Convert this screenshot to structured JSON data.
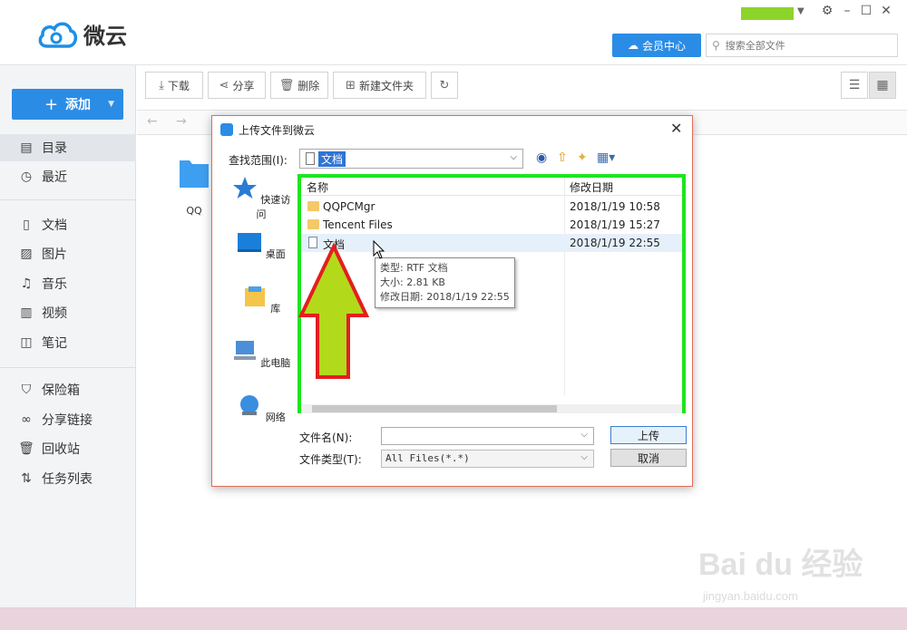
{
  "app": {
    "name": "微云",
    "vip_label": "会员中心",
    "search_placeholder": "搜索全部文件",
    "user_color": "#8dd42a"
  },
  "window_controls": [
    "gear-icon",
    "minimize-icon",
    "maximize-icon",
    "close-icon"
  ],
  "sidebar": {
    "add_label": "添加",
    "items": [
      {
        "label": "目录",
        "icon": "directory-icon"
      },
      {
        "label": "最近",
        "icon": "clock-icon"
      },
      {
        "label": "文档",
        "icon": "document-icon"
      },
      {
        "label": "图片",
        "icon": "image-icon"
      },
      {
        "label": "音乐",
        "icon": "music-icon"
      },
      {
        "label": "视频",
        "icon": "video-icon"
      },
      {
        "label": "笔记",
        "icon": "note-icon"
      },
      {
        "label": "保险箱",
        "icon": "shield-icon"
      },
      {
        "label": "分享链接",
        "icon": "link-icon"
      },
      {
        "label": "回收站",
        "icon": "trash-icon"
      },
      {
        "label": "任务列表",
        "icon": "task-icon"
      }
    ]
  },
  "toolbar": {
    "download": "下载",
    "share": "分享",
    "delete": "删除",
    "new_folder": "新建文件夹"
  },
  "main": {
    "folder_label": "QQ"
  },
  "dialog": {
    "title": "上传文件到微云",
    "lookin_label": "查找范围(I):",
    "lookin_value": "文档",
    "places": [
      "快速访问",
      "桌面",
      "库",
      "此电脑",
      "网络"
    ],
    "columns": [
      "名称",
      "修改日期"
    ],
    "files": [
      {
        "name": "QQPCMgr",
        "date": "2018/1/19 10:58",
        "kind": "folder"
      },
      {
        "name": "Tencent Files",
        "date": "2018/1/19 15:27",
        "kind": "folder"
      },
      {
        "name": "文档",
        "date": "2018/1/19 22:55",
        "kind": "document"
      }
    ],
    "tooltip": {
      "type": "类型: RTF 文档",
      "size": "大小: 2.81 KB",
      "modified": "修改日期: 2018/1/19 22:55"
    },
    "filename_label": "文件名(N):",
    "filetype_label": "文件类型(T):",
    "filetype_value": "All Files(*.*)",
    "upload_label": "上传",
    "cancel_label": "取消"
  },
  "watermark": {
    "text": "Bai du 经验",
    "url": "jingyan.baidu.com"
  }
}
